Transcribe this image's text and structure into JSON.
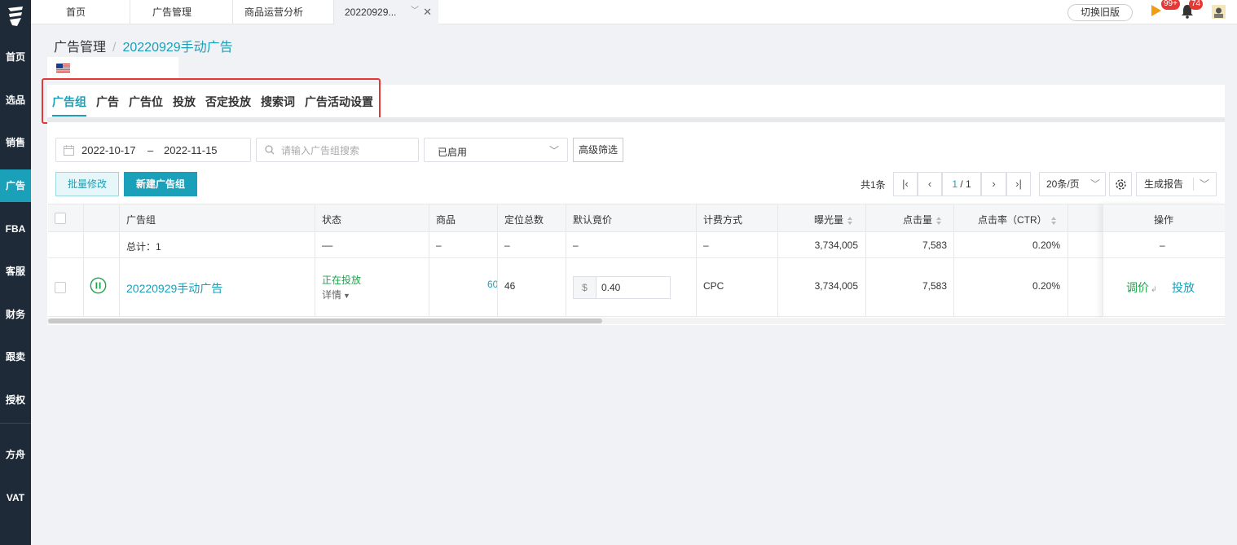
{
  "sidebar": {
    "items": [
      {
        "label": "首页"
      },
      {
        "label": "选品"
      },
      {
        "label": "销售"
      },
      {
        "label": "广告"
      },
      {
        "label": "FBA"
      },
      {
        "label": "客服"
      },
      {
        "label": "财务"
      },
      {
        "label": "跟卖"
      },
      {
        "label": "授权"
      },
      {
        "label": "方舟"
      },
      {
        "label": "VAT"
      }
    ],
    "active": "广告"
  },
  "topbar": {
    "tabs": [
      {
        "label": "首页"
      },
      {
        "label": "广告管理"
      },
      {
        "label": "商品运营分析"
      },
      {
        "label": "20220929..."
      }
    ],
    "switch_label": "切换旧版",
    "flag_badge": "99+",
    "bell_badge": "74"
  },
  "breadcrumb": {
    "parent": "广告管理",
    "separator": "/",
    "current": "20220929手动广告"
  },
  "subtabs": [
    {
      "label": "广告组"
    },
    {
      "label": "广告"
    },
    {
      "label": "广告位"
    },
    {
      "label": "投放"
    },
    {
      "label": "否定投放"
    },
    {
      "label": "搜索词"
    },
    {
      "label": "广告活动设置"
    }
  ],
  "filters": {
    "date_start": "2022-10-17",
    "date_sep": "–",
    "date_end": "2022-11-15",
    "search_placeholder": "请输入广告组搜索",
    "status_value": "已启用",
    "advanced_label": "高级筛选"
  },
  "actions": {
    "batch_label": "批量修改",
    "new_label": "新建广告组",
    "total": "共1条",
    "page_current": "1",
    "page_total": "/ 1",
    "page_size": "20条/页",
    "report_label": "生成报告"
  },
  "table": {
    "headers": {
      "group": "广告组",
      "status": "状态",
      "product": "商品",
      "targets": "定位总数",
      "bid": "默认竟价",
      "billing": "计费方式",
      "impressions": "曝光量",
      "clicks": "点击量",
      "ctr": "点击率（CTR）",
      "ops": "操作"
    },
    "summary": {
      "label": "总计：1",
      "status": "––",
      "product": "–",
      "targets": "–",
      "bid": "–",
      "billing": "–",
      "impressions": "3,734,005",
      "clicks": "7,583",
      "ctr": "0.20%",
      "ops": "–"
    },
    "rows": [
      {
        "name": "20220929手动广告",
        "status": "正在投放",
        "detail": "详情",
        "product": "60",
        "targets": "46",
        "currency": "$",
        "bid": "0.40",
        "billing": "CPC",
        "impressions": "3,734,005",
        "clicks": "7,583",
        "ctr": "0.20%",
        "op_adjust": "调价",
        "op_target": "投放"
      }
    ]
  },
  "colors": {
    "accent": "#1aa0b8",
    "sidebar": "#1e2a38",
    "green": "#1ea34a",
    "highlight": "#e53935"
  }
}
